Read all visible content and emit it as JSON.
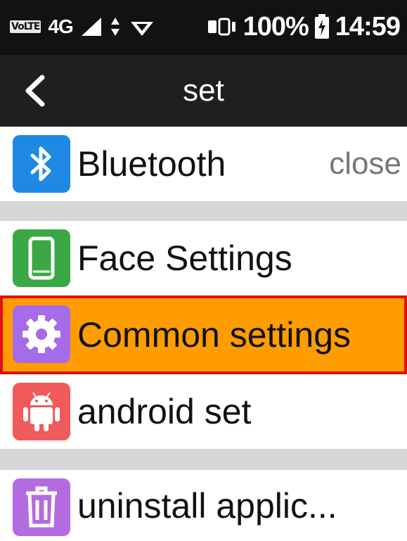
{
  "status_bar": {
    "volte": "VoLTE",
    "network": "4G",
    "battery_percent": "100%",
    "time": "14:59",
    "icons": [
      "volte-icon",
      "signal-icon",
      "data-arrows-icon",
      "wifi-icon",
      "vibrate-icon",
      "battery-icon"
    ]
  },
  "header": {
    "title": "set",
    "back_icon": "back-arrow-icon"
  },
  "items": [
    {
      "label": "Bluetooth",
      "value": "close",
      "icon": "bluetooth-icon",
      "icon_color": "#1e88e5"
    },
    {
      "label": "Face Settings",
      "icon": "phone-icon",
      "icon_color": "#3aa845"
    },
    {
      "label": "Common settings",
      "icon": "gear-icon",
      "icon_color": "#a56be8",
      "selected": true
    },
    {
      "label": "android set",
      "icon": "android-icon",
      "icon_color": "#f05a5a"
    },
    {
      "label": "uninstall applic...",
      "icon": "trash-icon",
      "icon_color": "#b56be0"
    }
  ],
  "colors": {
    "selected_bg": "#ff9d00",
    "selected_border": "#e01010",
    "title_bar": "#1f1f1f",
    "status_bar": "#121212"
  }
}
